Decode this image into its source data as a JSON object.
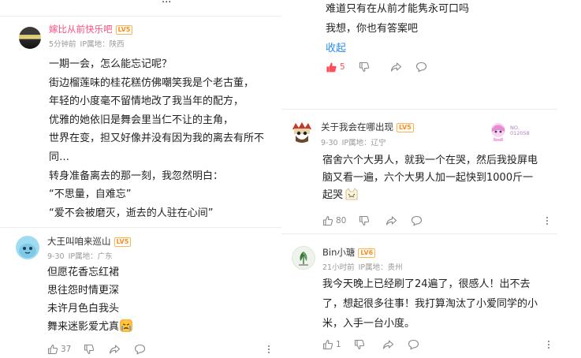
{
  "left_column": {
    "top_fragment": "...",
    "comment1": {
      "username": "嫁比从前快乐吧",
      "level": "LV5",
      "time": "5分钟前",
      "ip": "IP属地：陕西",
      "lines": [
        "一期一会，怎么能忘记呢？",
        "街边榴莲味的桂花糕仿佛嘲笑我是个老古董，",
        "年轻的小度毫不留情地改了我当年的配方，",
        "优雅的她依旧是舞会里当仁不让的主角，",
        "世界在变，担又好像并没有因为我的离去有所不",
        "同…",
        "转身准备离去的那一刻，我忽然明白：",
        "“不思量，自难忘”",
        "“爱不会被磨灭，逝去的人驻在心间”"
      ]
    },
    "comment2": {
      "username": "大王叫咱来巡山",
      "level": "LV5",
      "time": "9-30",
      "ip": "IP属地：广东",
      "lines": [
        "但愿花香忘红裙",
        "思往怨时情更深",
        "未许月色白我头",
        "舞来迷影爱尤真"
      ],
      "likes": "37"
    }
  },
  "right_column": {
    "comment0_tail": {
      "lines": [
        "难道只有在从前才能隽永可口吗",
        "我想，你也有答案吧"
      ],
      "collapse_label": "收起",
      "likes": "5"
    },
    "comment3": {
      "username": "关于我会在哪出现",
      "level": "LV5",
      "time": "9-30",
      "ip": "IP属地：辽宁",
      "badge_text": "NO.",
      "badge_number": "012058",
      "lines": [
        "宿舍六个大男人，就我一个在哭，然后我投屏电",
        "脑又看一遍，六个大男人加一起快到1000斤一",
        "起哭"
      ],
      "likes": "80"
    },
    "comment4": {
      "username": "Bin小瑭",
      "level": "LV6",
      "time": "21小时前",
      "ip": "IP属地：贵州",
      "lines": [
        "我今天晚上已经刷了24遍了，很感人！出不去",
        "了，想起很多往事！我打算淘汰了小爱同学的小",
        "米，入手一台小度。"
      ],
      "likes": "1"
    }
  },
  "colors": {
    "accent_red": "#ff4d5a",
    "link_blue": "#2a8df0",
    "level_orange": "#ff8c1a"
  },
  "icons": [
    "thumb-up-icon",
    "thumb-down-icon",
    "share-icon",
    "comment-icon",
    "more-icon"
  ]
}
